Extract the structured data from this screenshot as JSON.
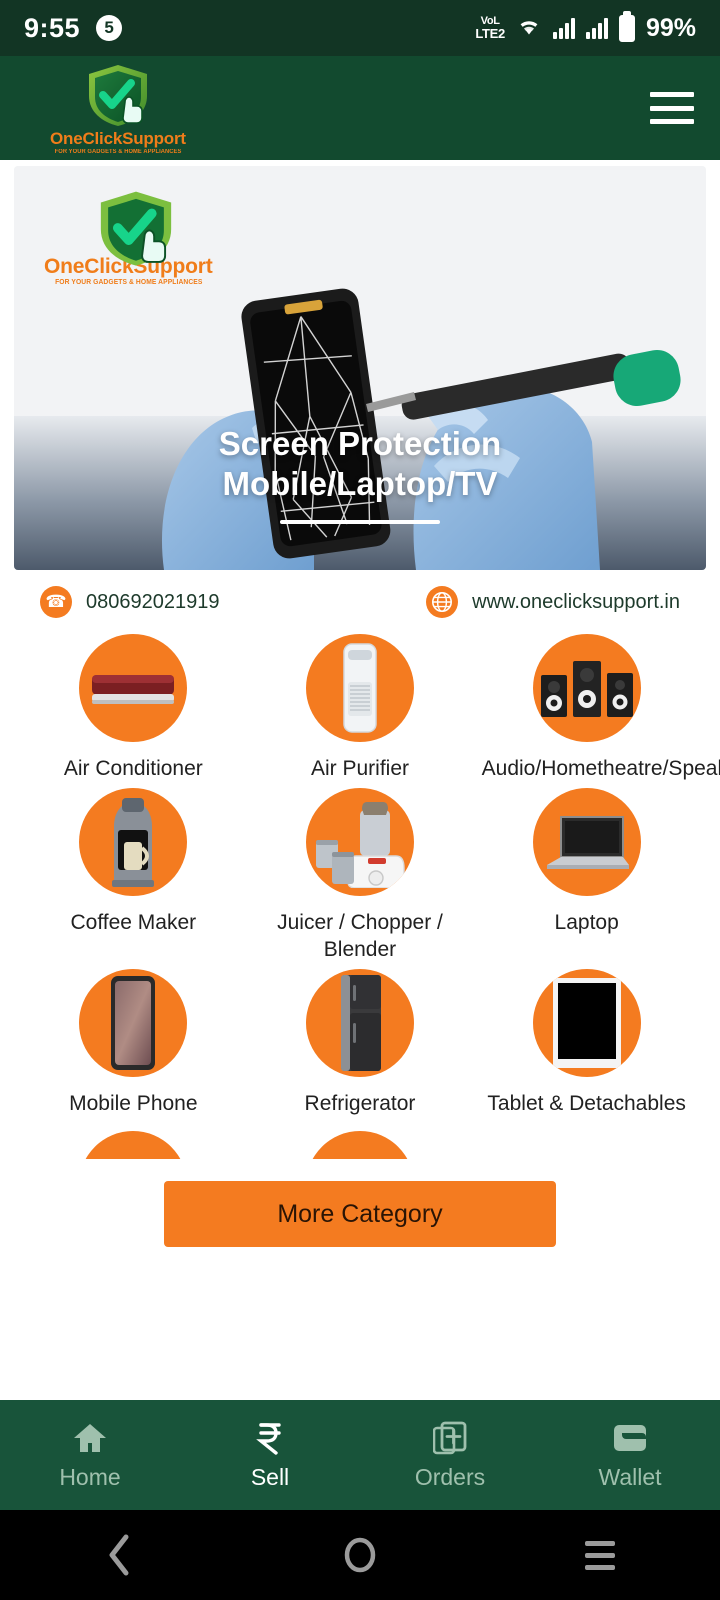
{
  "status_bar": {
    "time": "9:55",
    "notification_count": "5",
    "network_line1": "VoL",
    "network_line2": "LTE2",
    "battery_percent": "99%",
    "background_color": "#123524"
  },
  "app_bar": {
    "brand_name": "OneClickSupport",
    "brand_tagline": "FOR YOUR GADGETS & HOME APPLIANCES",
    "menu_icon": "hamburger-menu-icon",
    "background_color": "#124A2F",
    "brand_color": "#F07D1A"
  },
  "banner": {
    "logo_name": "OneClickSupport",
    "logo_tagline": "FOR YOUR GADGETS & HOME APPLIANCES",
    "title_line1": "Screen Protection",
    "title_line2": "Mobile/Laptop/TV",
    "image_description": "gloved-hands-repairing-cracked-phone"
  },
  "contact": {
    "phone_icon": "phone-icon",
    "phone": "080692021919",
    "web_icon": "globe-icon",
    "website": "www.oneclicksupport.in"
  },
  "categories": {
    "accent_color": "#F47B20",
    "items": [
      {
        "label": "Air Conditioner",
        "icon": "air-conditioner-icon"
      },
      {
        "label": "Air Purifier",
        "icon": "air-purifier-icon"
      },
      {
        "label": "Audio/Hometheatre/Speaker",
        "icon": "speaker-icon"
      },
      {
        "label": "Coffee Maker",
        "icon": "coffee-maker-icon"
      },
      {
        "label": "Juicer / Chopper / Blender",
        "icon": "blender-icon"
      },
      {
        "label": "Laptop",
        "icon": "laptop-icon"
      },
      {
        "label": "Mobile Phone",
        "icon": "mobile-phone-icon"
      },
      {
        "label": "Refrigerator",
        "icon": "refrigerator-icon"
      },
      {
        "label": "Tablet & Detachables",
        "icon": "tablet-icon"
      }
    ]
  },
  "more_button": {
    "label": "More Category"
  },
  "bottom_nav": {
    "background_color": "#18543A",
    "items": [
      {
        "label": "Home",
        "icon": "home-icon",
        "active": false
      },
      {
        "label": "Sell",
        "icon": "rupee-icon",
        "active": true
      },
      {
        "label": "Orders",
        "icon": "orders-icon",
        "active": false
      },
      {
        "label": "Wallet",
        "icon": "wallet-icon",
        "active": false
      }
    ]
  },
  "android_nav": {
    "back": "back-icon",
    "home": "home-circle-icon",
    "recents": "recents-icon"
  }
}
